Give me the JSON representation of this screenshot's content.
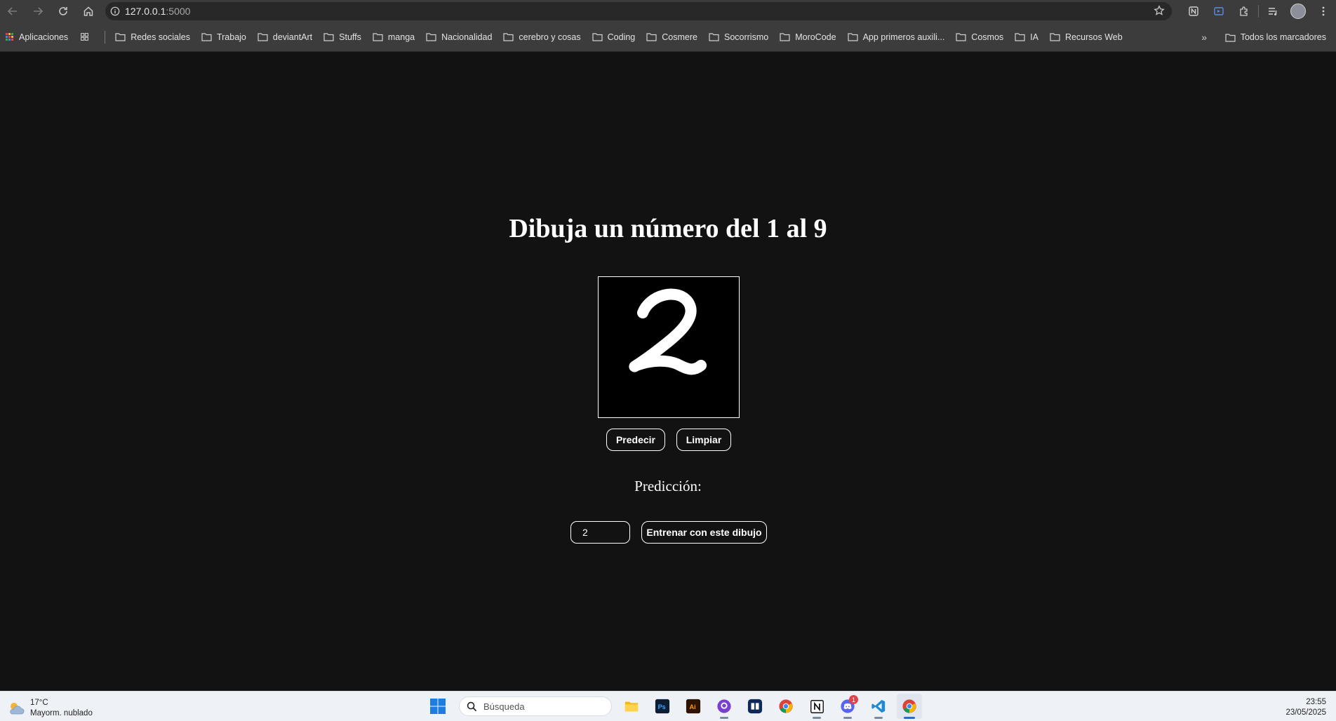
{
  "browser": {
    "url_host": "127.0.0.1",
    "url_port": ":5000"
  },
  "bookmarks": {
    "apps_label": "Aplicaciones",
    "items": [
      "Redes sociales",
      "Trabajo",
      "deviantArt",
      "Stuffs",
      "manga",
      "Nacionalidad",
      "cerebro y cosas",
      "Coding",
      "Cosmere",
      "Socorrismo",
      "MoroCode",
      "App primeros auxili...",
      "Cosmos",
      "IA",
      "Recursos Web"
    ],
    "all_label": "Todos los marcadores"
  },
  "page": {
    "title": "Dibuja un número del 1 al 9",
    "predict_label": "Predecir",
    "clear_label": "Limpiar",
    "prediction_label": "Predicción:",
    "digit_value": "2",
    "train_label": "Entrenar con este dibujo"
  },
  "taskbar": {
    "temperature": "17°C",
    "weather": "Mayorm. nublado",
    "search_placeholder": "Búsqueda",
    "time": "23:55",
    "date": "23/05/2025",
    "discord_badge": "1"
  },
  "colors": {
    "page_bg": "#121212",
    "chrome_bg": "#3c3c3c",
    "taskbar_bg": "#eef2f7"
  }
}
